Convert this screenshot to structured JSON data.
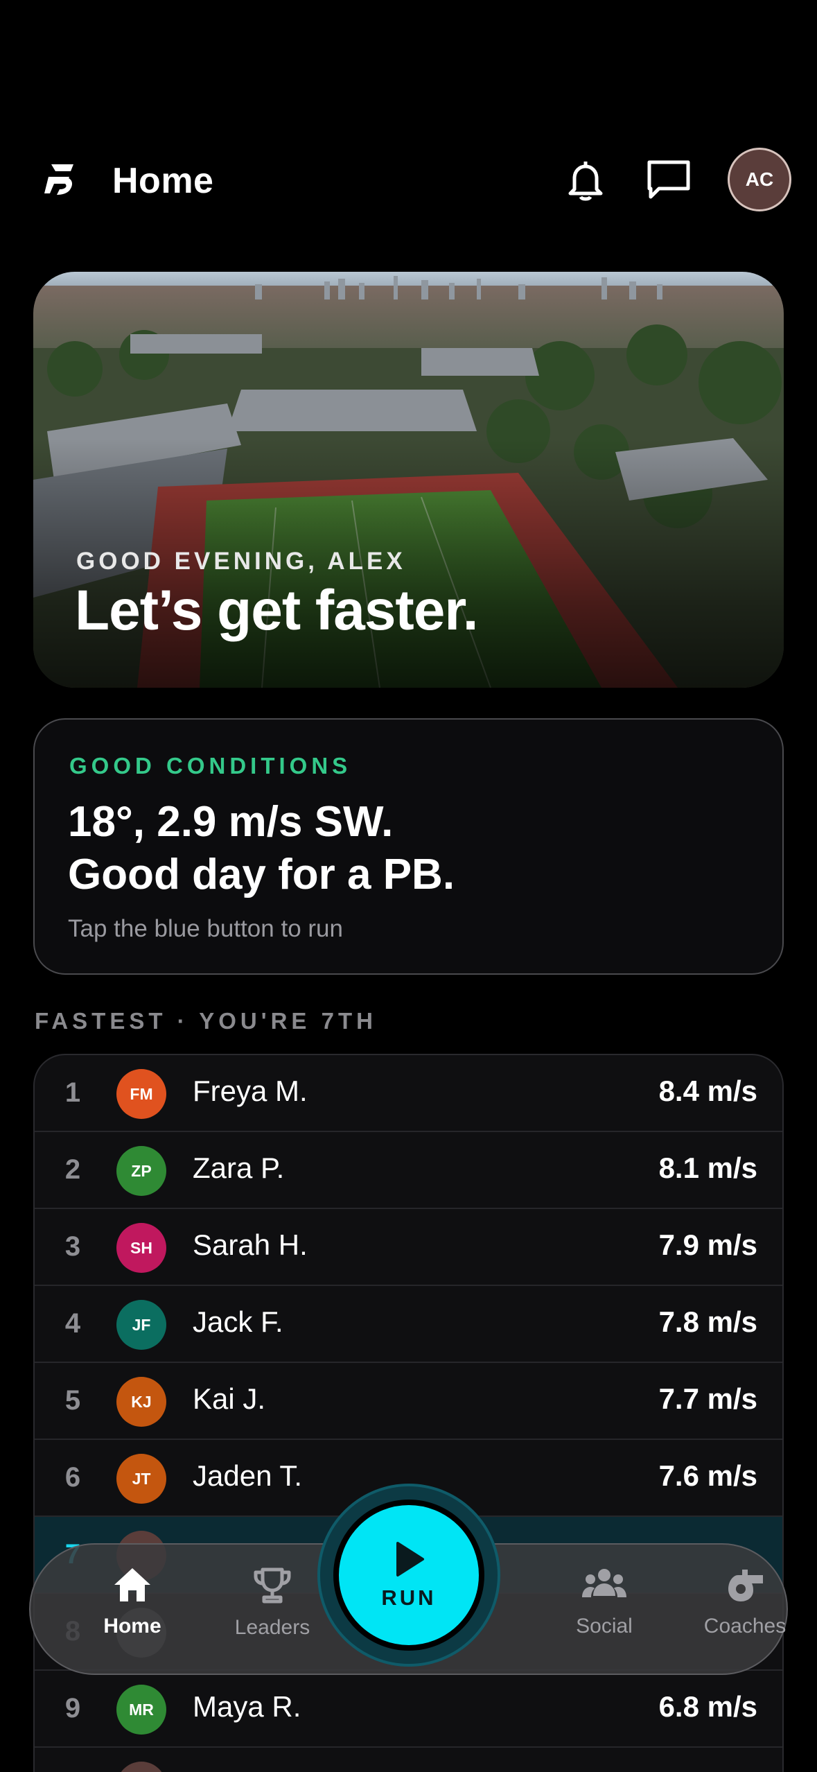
{
  "header": {
    "title": "Home",
    "avatar_initials": "AC",
    "logo_icon": "fastest-logo-icon",
    "bell_icon": "bell-icon",
    "chat_icon": "chat-icon"
  },
  "hero": {
    "kicker": "GOOD EVENING, ALEX",
    "title": "Let’s get faster."
  },
  "conditions": {
    "kicker": "GOOD CONDITIONS",
    "line1": "18°, 2.9 m/s SW.",
    "line2": "Good day for a PB.",
    "hint": "Tap the blue button to run",
    "accent": "#34c98a"
  },
  "leaderboard": {
    "heading": "FASTEST · YOU'RE 7TH",
    "rows": [
      {
        "rank": "1",
        "initials": "FM",
        "name": "Freya M.",
        "speed": "8.4 m/s",
        "color": "#e0521f"
      },
      {
        "rank": "2",
        "initials": "ZP",
        "name": "Zara P.",
        "speed": "8.1 m/s",
        "color": "#2f8a34"
      },
      {
        "rank": "3",
        "initials": "SH",
        "name": "Sarah H.",
        "speed": "7.9 m/s",
        "color": "#c0185e"
      },
      {
        "rank": "4",
        "initials": "JF",
        "name": "Jack F.",
        "speed": "7.8 m/s",
        "color": "#0b6e60"
      },
      {
        "rank": "5",
        "initials": "KJ",
        "name": "Kai J.",
        "speed": "7.7 m/s",
        "color": "#c4560f"
      },
      {
        "rank": "6",
        "initials": "JT",
        "name": "Jaden T.",
        "speed": "7.6 m/s",
        "color": "#c4560f"
      },
      {
        "rank": "7",
        "initials": "",
        "name": "",
        "speed": "",
        "color": "#5a3d3a"
      },
      {
        "rank": "8",
        "initials": "",
        "name": "",
        "speed": "",
        "color": "#555"
      },
      {
        "rank": "9",
        "initials": "MR",
        "name": "Maya R.",
        "speed": "6.8 m/s",
        "color": "#2f8a34"
      },
      {
        "rank": "",
        "initials": "",
        "name": "",
        "speed": "",
        "color": "#5a3d3a"
      }
    ]
  },
  "nav": {
    "home": "Home",
    "leaders": "Leaders",
    "run": "RUN",
    "social": "Social",
    "coaches": "Coaches",
    "run_color": "#00e5f5"
  }
}
